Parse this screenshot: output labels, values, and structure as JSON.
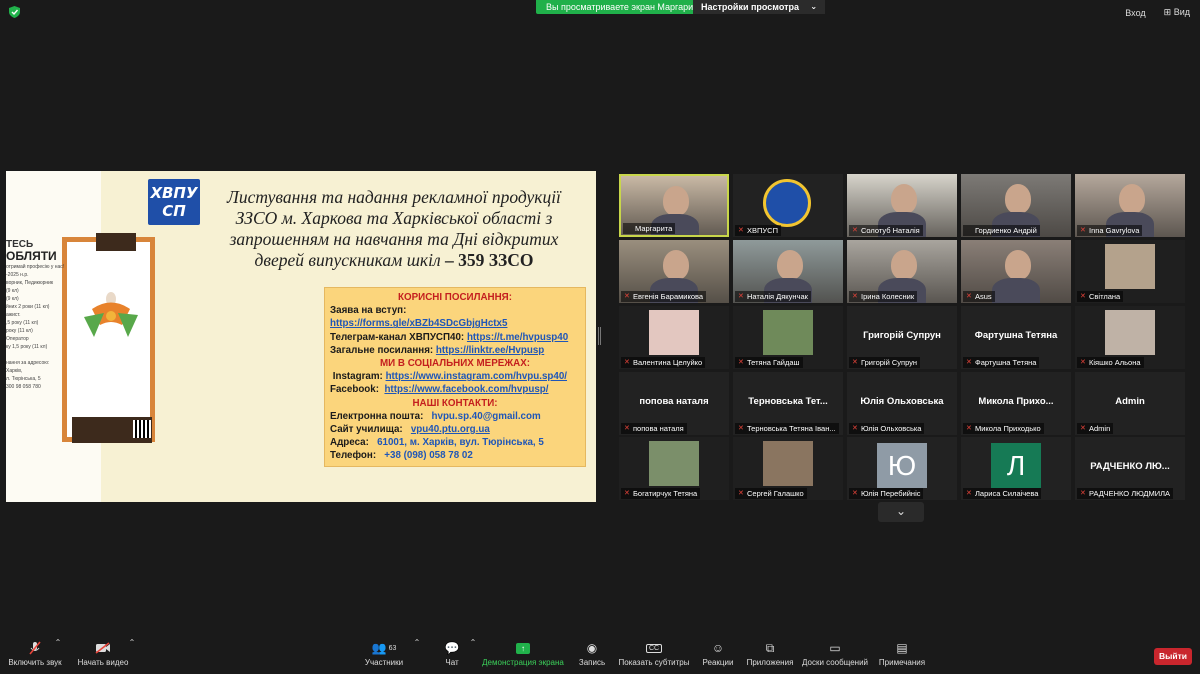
{
  "topbar": {
    "share_banner": "Вы просматриваете экран Маргарита",
    "view_options": "Настройки просмотра",
    "exit_fullscreen": "Вход",
    "view": "Вид"
  },
  "slide": {
    "logo_text": "ХВПУ СП",
    "title_lines": [
      "Листування та надання рекламної продукції",
      "ЗЗСО м. Харкова та Харківської області  з",
      "запрошенням на навчання та Дні відкритих",
      "дверей випускникам шкіл"
    ],
    "title_count": " – 359 ЗЗСО",
    "poster": {
      "line1": "ТЕСЬ",
      "line2": "ОБЛЯТИ",
      "line3": "отримай професію у нас!",
      "line4": "-2025 н.р.",
      "line5": "ворник, Педикюрник",
      "line6": "(9 кл)",
      "line7": "(9 кл)",
      "line8": "йних 2 роки (11 кл)",
      "line9": "ажист.",
      "line10": ",5 року (11 кл)",
      "line11": "року (11 кл)",
      "line12": "Оператор",
      "line13": "ку 1,5 року (11 кл)",
      "line14": "нання за адресою:",
      "line15": "Харків,",
      "line16": "л. Тюрінська, 5",
      "line17": "300 98 058 780"
    },
    "links": {
      "useful_header": "КОРИСНІ ПОСИЛАННЯ:",
      "apply_label": "Заява на вступ:",
      "apply_url": "https://forms.gle/xBZb4SDcGbjgHctx5",
      "telegram_label": "Телеграм-канал ХВПУСП40:",
      "telegram_url": "https://t.me/hvpusp40",
      "general_label": "Загальне посилання:",
      "general_url": "https://linktr.ee/Hvpusp",
      "social_header": "МИ В СОЦІАЛЬНИХ МЕРЕЖАХ:",
      "instagram_label": "Instagram:",
      "instagram_url": "https://www.instagram.com/hvpu.sp40/",
      "facebook_label": "Facebook:",
      "facebook_url": "https://www.facebook.com/hvpusp/",
      "contacts_header": "НАШІ КОНТАКТИ:",
      "email_label": "Електронна пошта:",
      "email_value": "hvpu.sp.40@gmail.com",
      "site_label": "Сайт училища:",
      "site_value": "vpu40.ptu.org.ua",
      "address_label": "Адреса:",
      "address_value": "61001, м. Харків, вул. Тюрінська, 5",
      "phone_label": "Телефон:",
      "phone_value": "+38 (098) 058 78 02"
    }
  },
  "gallery": [
    {
      "label": "Маргарита",
      "kind": "photo",
      "bg": "#c9b9a5",
      "active": true,
      "muted": false
    },
    {
      "label": "ХВПУСП",
      "kind": "logo",
      "bg": "#1f1f1f",
      "muted": true
    },
    {
      "label": "Солотуб Наталія",
      "kind": "photo",
      "bg": "#d7d4cb",
      "muted": true
    },
    {
      "label": "Гордиенко Андрій",
      "kind": "photo",
      "bg": "#7d7a76",
      "muted": false
    },
    {
      "label": "Inna Gavrylova",
      "kind": "photo",
      "bg": "#b5a89c",
      "muted": true
    },
    {
      "label": "Евгенія Барамикова",
      "kind": "photo",
      "bg": "#9a8f7e",
      "muted": true
    },
    {
      "label": "Наталія Дякунчак",
      "kind": "photo",
      "bg": "#8f9a9a",
      "muted": true
    },
    {
      "label": "Ірина Колесник",
      "kind": "photo",
      "bg": "#a9a59e",
      "muted": true
    },
    {
      "label": "Asus",
      "kind": "photo",
      "bg": "#8a7f77",
      "muted": true
    },
    {
      "label": "Світлана",
      "kind": "avatar",
      "bg": "#1f1f1f",
      "avatar_color": "#b4a28c",
      "muted": true
    },
    {
      "label": "Валентина Целуйко",
      "kind": "avatar",
      "bg": "#1f1f1f",
      "avatar_color": "#e3c7c0",
      "muted": true
    },
    {
      "label": "Тетяна Гайдаш",
      "kind": "avatar",
      "bg": "#1f1f1f",
      "avatar_color": "#6f8a5a",
      "muted": true
    },
    {
      "label": "Григорій Супрун",
      "kind": "name",
      "bigname": "Григорій Супрун",
      "muted": true
    },
    {
      "label": "Фартушна Тетяна",
      "kind": "name",
      "bigname": "Фартушна Тетяна",
      "muted": true
    },
    {
      "label": "Кіяшко Альона",
      "kind": "avatar",
      "bg": "#1f1f1f",
      "avatar_color": "#bfb2a6",
      "muted": true
    },
    {
      "label": "попова наталя",
      "kind": "name",
      "bigname": "попова наталя",
      "muted": true
    },
    {
      "label": "Терновська Тетяна Іван...",
      "kind": "name",
      "bigname": "Терновська  Тет...",
      "muted": true
    },
    {
      "label": "Юлія Ольховська",
      "kind": "name",
      "bigname": "Юлія Ольховська",
      "muted": true
    },
    {
      "label": "Микола Приходько",
      "kind": "name",
      "bigname": "Микола  Прихо...",
      "muted": true
    },
    {
      "label": "Admin",
      "kind": "name",
      "bigname": "Admin",
      "muted": true
    },
    {
      "label": "Богатирчук Тетяна",
      "kind": "avatar",
      "bg": "#1f1f1f",
      "avatar_color": "#7b8f6a",
      "muted": true
    },
    {
      "label": "Сергей Галашко",
      "kind": "avatar",
      "bg": "#1f1f1f",
      "avatar_color": "#8a7560",
      "muted": true
    },
    {
      "label": "Юлія Перебийніс",
      "kind": "letter",
      "letter": "Ю",
      "letter_bg": "#8f9ba6",
      "muted": true
    },
    {
      "label": "Лариса Силаічева",
      "kind": "letter",
      "letter": "Л",
      "letter_bg": "#167a55",
      "muted": true
    },
    {
      "label": "РАДЧЕНКО ЛЮДМИЛА",
      "kind": "name",
      "bigname": "РАДЧЕНКО  ЛЮ...",
      "muted": true
    }
  ],
  "toolbar": {
    "audio": "Включить звук",
    "video": "Начать видео",
    "participants": "Участники",
    "participants_count": "63",
    "chat": "Чат",
    "share": "Демонстрация экрана",
    "record": "Запись",
    "captions": "Показать субтитры",
    "reactions": "Реакции",
    "apps": "Приложения",
    "whiteboards": "Доски сообщений",
    "notes": "Примечания",
    "leave": "Выйти"
  },
  "colors": {
    "share_green": "#20b04a",
    "leave_red": "#c9262d",
    "active_tile_border": "#c8d64a",
    "link_blue": "#1f56b8",
    "header_red": "#c41f1f",
    "links_box": "#fbd57c"
  }
}
